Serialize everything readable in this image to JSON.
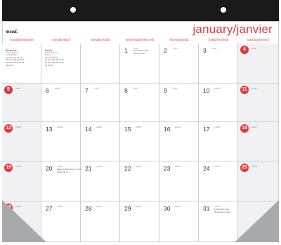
{
  "brand": "mead.",
  "month_title": "january/janvier",
  "day_headers": [
    "sunday/dimanche",
    "monday/lundi",
    "tuesday/mardi",
    "wednesday/mercredi",
    "thursday/jeudi",
    "friday/vendredi",
    "saturday/samedi"
  ],
  "mini_dec": {
    "title": "décembre",
    "days_row": "S M T W T F S",
    "rows": [
      "1 2 3 4 5 6 7",
      "8 9 10 11 12 13 14",
      "15 16 17 18 19 20 21",
      "22 23 24 25 26 27 28",
      "29 30 31"
    ]
  },
  "mini_feb": {
    "title": "février",
    "days_row": "S M T W T F S",
    "rows": [
      "1 2 3 4",
      "5 6 7 8 9 10 11",
      "12 13 14 15 16 17 18",
      "19 20 21 22 23 24 25",
      "26 27 28"
    ]
  },
  "week1": {
    "wed": {
      "num": "1",
      "tiny": "1/364",
      "note": [
        "New Year's Day",
        "Jour de l'An"
      ]
    },
    "thu": {
      "num": "2",
      "tiny": "2/363"
    },
    "fri": {
      "num": "3",
      "tiny": "3/362"
    },
    "sat": {
      "num": "4",
      "tiny": "4/361"
    }
  },
  "week2": [
    {
      "num": "5",
      "tiny": "5/360"
    },
    {
      "num": "6",
      "tiny": "6/359"
    },
    {
      "num": "7",
      "tiny": "7/358"
    },
    {
      "num": "8",
      "tiny": "8/357"
    },
    {
      "num": "9",
      "tiny": "9/356"
    },
    {
      "num": "10",
      "tiny": "10/355"
    },
    {
      "num": "11",
      "tiny": "11/354"
    }
  ],
  "week3": [
    {
      "num": "12",
      "tiny": "12/353"
    },
    {
      "num": "13",
      "tiny": "13/352"
    },
    {
      "num": "14",
      "tiny": "14/351"
    },
    {
      "num": "15",
      "tiny": "15/350"
    },
    {
      "num": "16",
      "tiny": "16/349"
    },
    {
      "num": "17",
      "tiny": "17/348"
    },
    {
      "num": "18",
      "tiny": "18/347"
    }
  ],
  "week4": [
    {
      "num": "19",
      "tiny": "19/346"
    },
    {
      "num": "20",
      "tiny": "20/345",
      "note": [
        "Martin Luther King, Jr. Day",
        "(USA) (É.-U.)"
      ]
    },
    {
      "num": "21",
      "tiny": "21/344"
    },
    {
      "num": "22",
      "tiny": "22/343"
    },
    {
      "num": "23",
      "tiny": "23/342"
    },
    {
      "num": "24",
      "tiny": "24/341"
    },
    {
      "num": "25",
      "tiny": "25/340"
    }
  ],
  "week5": [
    {
      "num": "26",
      "tiny": "26/339"
    },
    {
      "num": "27",
      "tiny": "27/338"
    },
    {
      "num": "28",
      "tiny": "28/337"
    },
    {
      "num": "29",
      "tiny": "29/336"
    },
    {
      "num": "30",
      "tiny": "30/335"
    },
    {
      "num": "31",
      "tiny": "31/334",
      "note": [
        "Lunar New Year",
        "Nouvel An lunaire"
      ]
    },
    {
      "num": "",
      "tiny": ""
    }
  ],
  "colors": {
    "accent": "#e0393b",
    "weekend_bg": "#f1f1f3",
    "bar": "#1a1a1a"
  }
}
